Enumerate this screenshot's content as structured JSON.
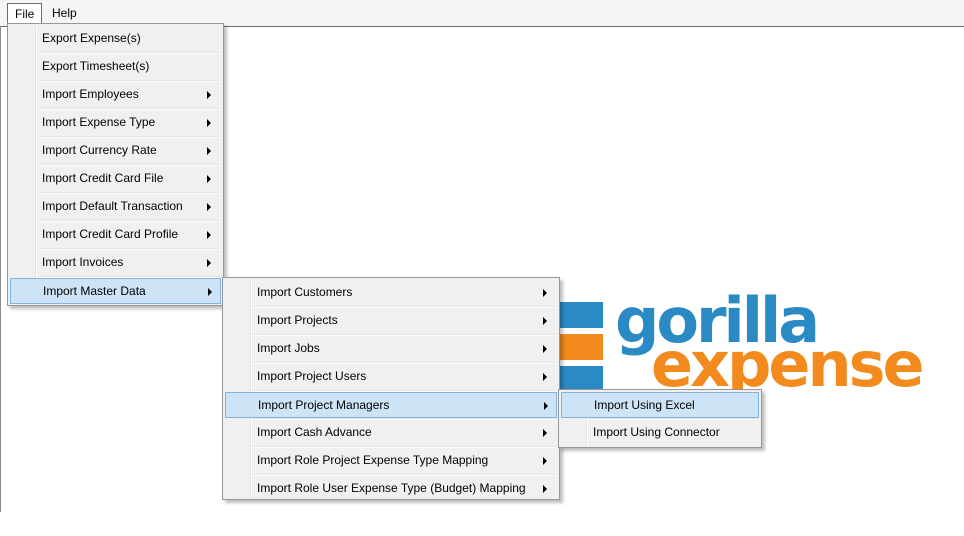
{
  "menubar": {
    "file": "File",
    "help": "Help"
  },
  "file_menu": {
    "items": [
      {
        "label": "Export Expense(s)",
        "submenu": false
      },
      {
        "label": "Export Timesheet(s)",
        "submenu": false
      },
      {
        "label": "Import Employees",
        "submenu": true
      },
      {
        "label": "Import Expense Type",
        "submenu": true
      },
      {
        "label": "Import Currency Rate",
        "submenu": true
      },
      {
        "label": "Import Credit Card File",
        "submenu": true
      },
      {
        "label": "Import Default Transaction",
        "submenu": true
      },
      {
        "label": "Import Credit Card Profile",
        "submenu": true
      },
      {
        "label": "Import Invoices",
        "submenu": true
      },
      {
        "label": "Import Master Data",
        "submenu": true,
        "highlighted": true
      }
    ]
  },
  "master_data_menu": {
    "items": [
      {
        "label": "Import Customers",
        "submenu": true
      },
      {
        "label": "Import Projects",
        "submenu": true
      },
      {
        "label": "Import Jobs",
        "submenu": true
      },
      {
        "label": "Import Project Users",
        "submenu": true
      },
      {
        "label": "Import Project Managers",
        "submenu": true,
        "highlighted": true
      },
      {
        "label": "Import Cash Advance",
        "submenu": true
      },
      {
        "label": "Import Role Project Expense Type Mapping",
        "submenu": true
      },
      {
        "label": "Import Role User Expense Type (Budget) Mapping",
        "submenu": true
      }
    ]
  },
  "project_managers_menu": {
    "items": [
      {
        "label": "Import Using Excel",
        "highlighted": true
      },
      {
        "label": "Import Using Connector"
      }
    ]
  },
  "logo": {
    "word1": "gorilla",
    "word2": "expense",
    "colors": {
      "blue": "#2a8ac4",
      "orange": "#f28a1e"
    }
  },
  "colors": {
    "highlight_bg": "#cde4f7",
    "highlight_border": "#7fb4e5",
    "menu_bg": "#f0f0f0"
  }
}
